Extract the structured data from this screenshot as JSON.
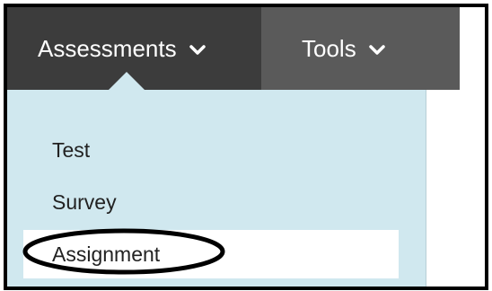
{
  "menu": {
    "tabs": [
      {
        "label": "Assessments",
        "icon": "chevron-down-icon",
        "active": true
      },
      {
        "label": "Tools",
        "icon": "chevron-down-icon",
        "active": false
      }
    ]
  },
  "dropdown": {
    "items": [
      {
        "label": "Test"
      },
      {
        "label": "Survey"
      },
      {
        "label": "Assignment",
        "highlighted": true
      }
    ]
  },
  "colors": {
    "menu_bar": "#5a5a5a",
    "active_tab": "#3c3c3c",
    "dropdown_bg": "#d0e8ef",
    "highlight_item": "#ffffff",
    "annotation_outline": "#000000"
  }
}
